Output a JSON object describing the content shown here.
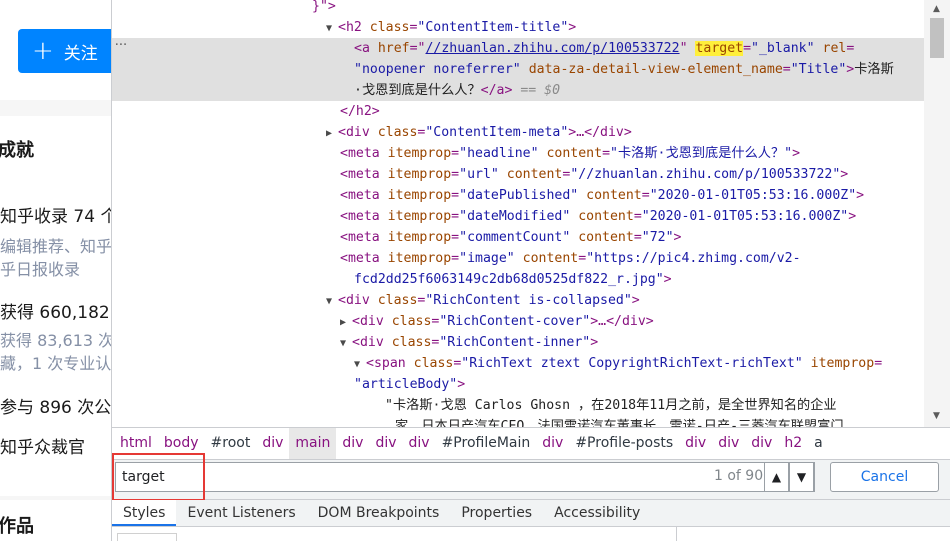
{
  "left": {
    "follow_label": "关注",
    "achievements_title": "成就",
    "recorded": "知乎收录 74 个",
    "recorded_sub1": "编辑推荐、知乎",
    "recorded_sub2": "乎日报收录",
    "got_votes": "获得 660,182",
    "got_sub1": "获得 83,613 次",
    "got_sub2": "藏，1 次专业认",
    "participated": "参与 896 次公",
    "arbiter": "知乎众裁官",
    "works_title": "作品"
  },
  "elements": {
    "l0": "}\">",
    "h2_open_tag": "<h2 ",
    "h2_class_name": "class",
    "h2_class_val": "\"ContentItem-title\"",
    "a_href_name": "href",
    "a_href_val": "//zhuanlan.zhihu.com/p/100533722",
    "a_target_name": "target",
    "a_target_val": "\"_blank\"",
    "a_rel_name": "rel",
    "a_rel_val": "\"noopener noreferrer\"",
    "a_za_name": "data-za-detail-view-element_name",
    "a_za_val": "\"Title\"",
    "a_text1": "卡洛斯",
    "a_text2": "·戈恩到底是什么人？",
    "a_close": "</a>",
    "a_eq": "== $0",
    "h2_close": "</h2>",
    "meta_div_class": "\"ContentItem-meta\"",
    "headline_val": "\"headline\"",
    "headline_content": "\"卡洛斯·戈恩到底是什么人？\"",
    "url_val": "\"url\"",
    "url_content": "\"//zhuanlan.zhihu.com/p/100533722\"",
    "date_pub_val": "\"datePublished\"",
    "date_pub_content": "\"2020-01-01T05:53:16.000Z\"",
    "date_mod_val": "\"dateModified\"",
    "date_mod_content": "\"2020-01-01T05:53:16.000Z\"",
    "comment_val": "\"commentCount\"",
    "comment_content": "\"72\"",
    "image_val": "\"image\"",
    "image_content1": "\"https://pic4.zhimg.com/v2-",
    "image_content2": "fcd2dd25f6063149c2db68d0525df822_r.jpg\"",
    "rich_class": "\"RichContent is-collapsed\"",
    "cover_class": "\"RichContent-cover\"",
    "inner_class": "\"RichContent-inner\"",
    "span_class": "\"RichText ztext CopyrightRichText-richText\"",
    "span_itemprop_val": "\"articleBody\"",
    "body_text1": "\"卡洛斯·戈恩 Carlos Ghosn ，在2018年11月之前，是全世界知名的企业",
    "body_text2": "家，日本日产汽车CEO，法国雷诺汽车董事长，雷诺-日产-三菱汽车联盟富门"
  },
  "breadcrumbs": [
    "html",
    "body",
    "#root",
    "div",
    "main",
    "div",
    "div",
    "div",
    "#ProfileMain",
    "div",
    "#Profile-posts",
    "div",
    "div",
    "div",
    "h2",
    "a"
  ],
  "search": {
    "value": "target",
    "match_count": "1 of 90",
    "cancel_label": "Cancel"
  },
  "tabs": [
    "Styles",
    "Event Listeners",
    "DOM Breakpoints",
    "Properties",
    "Accessibility"
  ]
}
